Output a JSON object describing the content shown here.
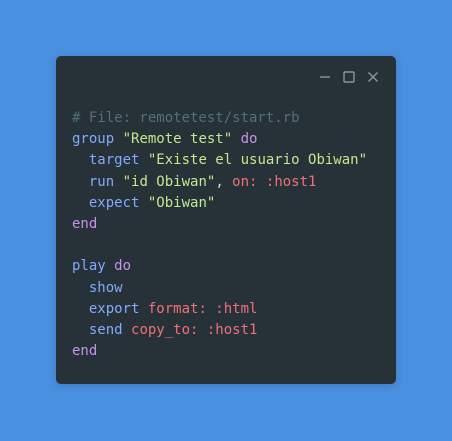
{
  "window": {
    "controls": [
      {
        "name": "minimize-icon"
      },
      {
        "name": "maximize-icon"
      },
      {
        "name": "close-icon"
      }
    ]
  },
  "code": {
    "lines": [
      [
        {
          "t": "comment",
          "v": "# File: remotetest/start.rb"
        }
      ],
      [
        {
          "t": "method",
          "v": "group"
        },
        {
          "t": "plain",
          "v": " "
        },
        {
          "t": "string",
          "v": "\"Remote test\""
        },
        {
          "t": "plain",
          "v": " "
        },
        {
          "t": "keyword",
          "v": "do"
        }
      ],
      [
        {
          "t": "plain",
          "v": "  "
        },
        {
          "t": "method",
          "v": "target"
        },
        {
          "t": "plain",
          "v": " "
        },
        {
          "t": "string",
          "v": "\"Existe el usuario Obiwan\""
        }
      ],
      [
        {
          "t": "plain",
          "v": "  "
        },
        {
          "t": "method",
          "v": "run"
        },
        {
          "t": "plain",
          "v": " "
        },
        {
          "t": "string",
          "v": "\"id Obiwan\""
        },
        {
          "t": "plain",
          "v": ", "
        },
        {
          "t": "symbol",
          "v": "on: :host1"
        }
      ],
      [
        {
          "t": "plain",
          "v": "  "
        },
        {
          "t": "method",
          "v": "expect"
        },
        {
          "t": "plain",
          "v": " "
        },
        {
          "t": "string",
          "v": "\"Obiwan\""
        }
      ],
      [
        {
          "t": "keyword",
          "v": "end"
        }
      ],
      [
        {
          "t": "plain",
          "v": ""
        }
      ],
      [
        {
          "t": "method",
          "v": "play"
        },
        {
          "t": "plain",
          "v": " "
        },
        {
          "t": "keyword",
          "v": "do"
        }
      ],
      [
        {
          "t": "plain",
          "v": "  "
        },
        {
          "t": "method",
          "v": "show"
        }
      ],
      [
        {
          "t": "plain",
          "v": "  "
        },
        {
          "t": "method",
          "v": "export"
        },
        {
          "t": "plain",
          "v": " "
        },
        {
          "t": "symbol",
          "v": "format: :html"
        }
      ],
      [
        {
          "t": "plain",
          "v": "  "
        },
        {
          "t": "method",
          "v": "send"
        },
        {
          "t": "plain",
          "v": " "
        },
        {
          "t": "symbol",
          "v": "copy_to: :host1"
        }
      ],
      [
        {
          "t": "keyword",
          "v": "end"
        }
      ]
    ]
  },
  "colors": {
    "background": "#4a90e0",
    "window": "#263238",
    "comment": "#546e7a",
    "method": "#82aaff",
    "string": "#c3e88d",
    "keyword": "#c792ea",
    "symbol": "#f07178",
    "controls": "#8a949a"
  }
}
